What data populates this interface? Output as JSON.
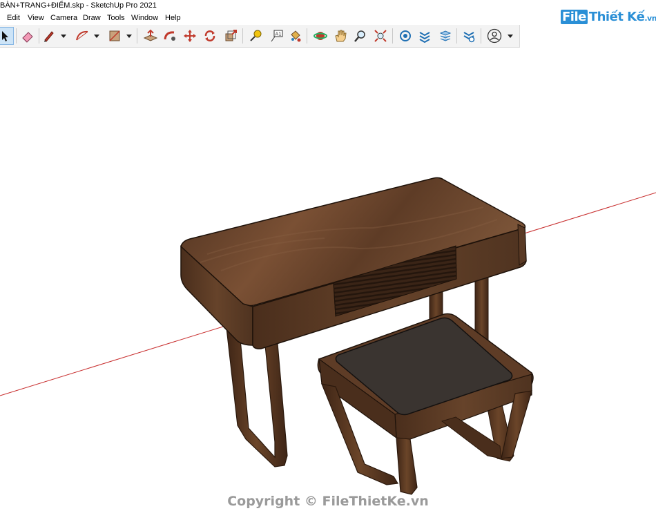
{
  "window": {
    "title": "BÀN+TRANG+ĐIỂM.skp - SketchUp Pro 2021"
  },
  "menu": {
    "items": [
      "Edit",
      "View",
      "Camera",
      "Draw",
      "Tools",
      "Window",
      "Help"
    ]
  },
  "toolbar": {
    "tools": [
      {
        "name": "select",
        "icon": "arrow-cursor-icon",
        "active": true
      },
      {
        "name": "eraser",
        "icon": "eraser-icon"
      },
      {
        "name": "line",
        "icon": "pencil-icon"
      },
      {
        "name": "arc",
        "icon": "arc-icon"
      },
      {
        "name": "shapes",
        "icon": "rectangle-icon"
      },
      {
        "name": "push-pull",
        "icon": "push-pull-icon"
      },
      {
        "name": "follow-me",
        "icon": "follow-me-icon"
      },
      {
        "name": "move",
        "icon": "move-icon"
      },
      {
        "name": "rotate",
        "icon": "rotate-icon"
      },
      {
        "name": "scale",
        "icon": "scale-icon"
      },
      {
        "name": "tape-measure",
        "icon": "tape-measure-icon"
      },
      {
        "name": "text",
        "icon": "text-icon"
      },
      {
        "name": "paint-bucket",
        "icon": "paint-bucket-icon"
      },
      {
        "name": "orbit",
        "icon": "orbit-icon"
      },
      {
        "name": "pan",
        "icon": "pan-hand-icon"
      },
      {
        "name": "zoom",
        "icon": "zoom-icon"
      },
      {
        "name": "zoom-extents",
        "icon": "zoom-extents-icon"
      },
      {
        "name": "warehouse",
        "icon": "3d-warehouse-icon"
      },
      {
        "name": "extension-warehouse",
        "icon": "extension-warehouse-icon"
      },
      {
        "name": "layout",
        "icon": "send-to-layout-icon"
      },
      {
        "name": "extension-manager",
        "icon": "extension-manager-icon"
      },
      {
        "name": "account",
        "icon": "user-account-icon"
      }
    ]
  },
  "logo": {
    "prefix": "File",
    "name": "Thiết Kế",
    "suffix": ".vn"
  },
  "watermark": {
    "text": "Copyright © FileThietKe.vn"
  },
  "colors": {
    "toolbar_bg": "#f3f3f3",
    "axis_red": "#c62828",
    "wood_dark": "#3e2516",
    "wood_mid": "#5a3a25",
    "wood_light": "#7a5338",
    "cushion": "#3a3430",
    "logo_blue": "#2a8fd6"
  }
}
